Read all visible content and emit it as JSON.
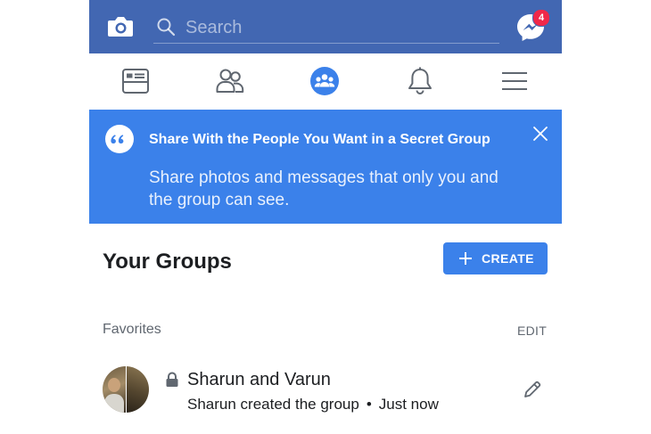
{
  "search": {
    "placeholder": "Search"
  },
  "messenger": {
    "badge_count": "4"
  },
  "colors": {
    "brand_blue": "#4267b2",
    "banner_blue": "#3b81ea",
    "badge_red": "#f02849"
  },
  "tabs": [
    {
      "icon": "news-feed-icon"
    },
    {
      "icon": "friends-icon"
    },
    {
      "icon": "groups-icon",
      "active": true
    },
    {
      "icon": "notifications-bell-icon"
    },
    {
      "icon": "menu-icon"
    }
  ],
  "banner": {
    "title": "Share With the People You Want in a Secret Group",
    "text": "Share photos and messages that only you and the group can see."
  },
  "groups": {
    "title": "Your Groups",
    "create_label": "CREATE",
    "favorites_label": "Favorites",
    "edit_label": "EDIT",
    "items": [
      {
        "name": "Sharun and Varun",
        "activity": "Sharun created the group",
        "separator": "•",
        "time": "Just now"
      }
    ]
  }
}
